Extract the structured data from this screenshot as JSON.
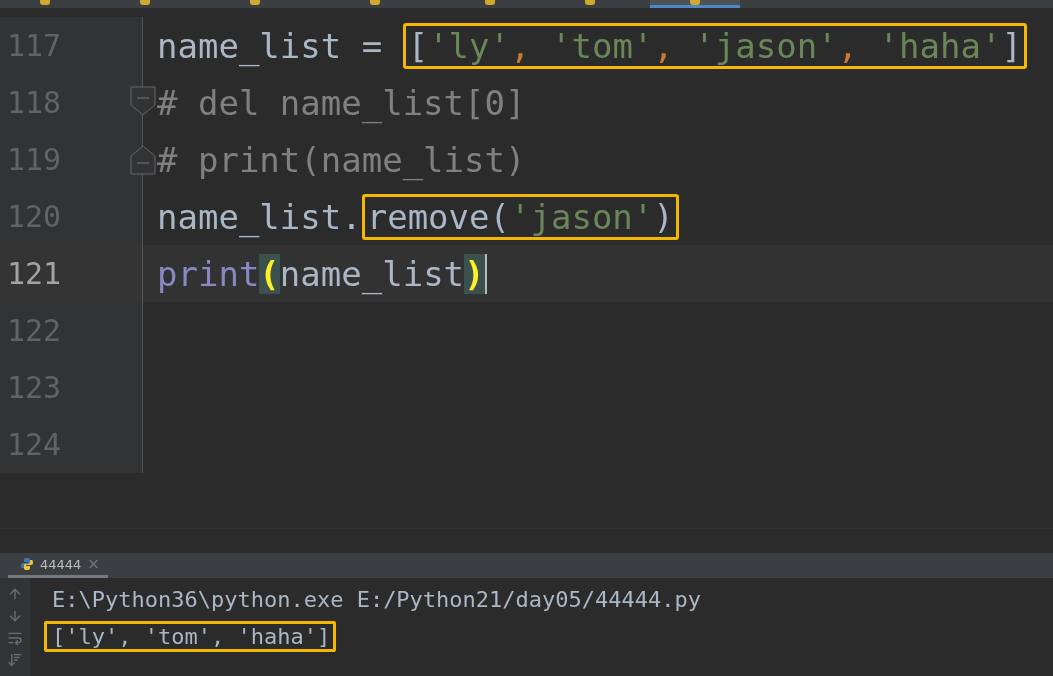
{
  "editor_tabs": [
    {
      "selected": false
    },
    {
      "selected": false
    },
    {
      "selected": false
    },
    {
      "selected": false
    },
    {
      "selected": false
    },
    {
      "selected": false
    },
    {
      "selected": true
    }
  ],
  "lines": [
    {
      "number": "117",
      "current": false,
      "kind": "code",
      "segments": [
        {
          "boxed": false,
          "tokens": [
            {
              "text": "name_list",
              "kind": "ident"
            },
            {
              "text": " = ",
              "kind": "plain"
            }
          ]
        },
        {
          "boxed": true,
          "tokens": [
            {
              "text": "[",
              "kind": "plain"
            },
            {
              "text": "'ly'",
              "kind": "string"
            },
            {
              "text": ", ",
              "kind": "comma"
            },
            {
              "text": "'tom'",
              "kind": "string"
            },
            {
              "text": ", ",
              "kind": "comma"
            },
            {
              "text": "'jason'",
              "kind": "string"
            },
            {
              "text": ", ",
              "kind": "comma"
            },
            {
              "text": "'haha'",
              "kind": "string"
            },
            {
              "text": "]",
              "kind": "plain"
            }
          ]
        }
      ]
    },
    {
      "number": "118",
      "current": false,
      "kind": "foldstart",
      "segments": [
        {
          "boxed": false,
          "tokens": [
            {
              "text": "# del name_list[0]",
              "kind": "comment"
            }
          ]
        }
      ]
    },
    {
      "number": "119",
      "current": false,
      "kind": "foldend",
      "segments": [
        {
          "boxed": false,
          "tokens": [
            {
              "text": "# print(name_list)",
              "kind": "comment"
            }
          ]
        }
      ]
    },
    {
      "number": "120",
      "current": false,
      "kind": "code",
      "segments": [
        {
          "boxed": false,
          "tokens": [
            {
              "text": "name_list.",
              "kind": "ident"
            }
          ]
        },
        {
          "boxed": true,
          "tokens": [
            {
              "text": "remove(",
              "kind": "ident"
            },
            {
              "text": "'jason'",
              "kind": "string"
            },
            {
              "text": ")",
              "kind": "ident"
            }
          ]
        }
      ]
    },
    {
      "number": "121",
      "current": true,
      "kind": "code",
      "segments": [
        {
          "boxed": false,
          "tokens": [
            {
              "text": "print",
              "kind": "builtin"
            },
            {
              "text": "(",
              "kind": "matched"
            },
            {
              "text": "name_list",
              "kind": "ident"
            },
            {
              "text": ")",
              "kind": "matched"
            }
          ]
        }
      ]
    },
    {
      "number": "122",
      "current": false,
      "kind": "code"
    },
    {
      "number": "123",
      "current": false,
      "kind": "code"
    },
    {
      "number": "124",
      "current": false,
      "kind": "code"
    }
  ],
  "run_panel": {
    "tab": {
      "label": "44444",
      "close": "×",
      "selected": true
    },
    "output": [
      {
        "text": "E:\\Python36\\python.exe E:/Python21/day05/44444.py",
        "boxed": false
      },
      {
        "text": "['ly', 'tom', 'haha']",
        "boxed": true
      }
    ]
  }
}
